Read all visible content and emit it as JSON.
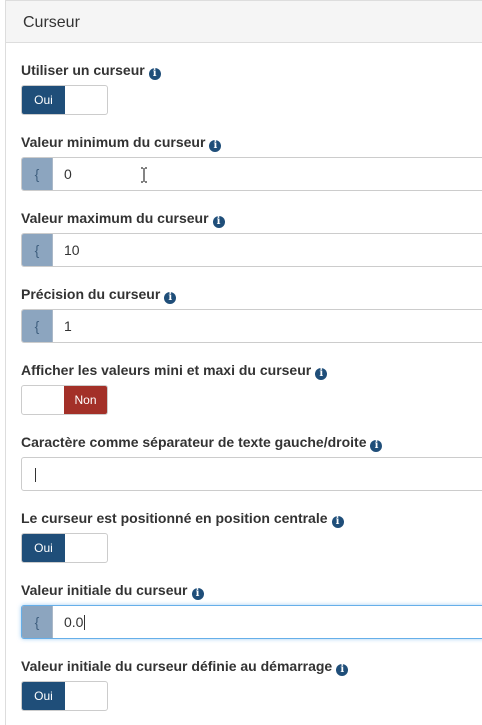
{
  "panel": {
    "title": "Curseur"
  },
  "info_glyph": "i",
  "fields": [
    {
      "label": "Utiliser un curseur",
      "type": "toggle",
      "state": "Oui"
    },
    {
      "label": "Valeur minimum du curseur",
      "type": "input",
      "addon": "{",
      "value": "0"
    },
    {
      "label": "Valeur maximum du curseur",
      "type": "input",
      "addon": "{",
      "value": "10"
    },
    {
      "label": "Précision du curseur",
      "type": "input",
      "addon": "{",
      "value": "1"
    },
    {
      "label": "Afficher les valeurs mini et maxi du curseur",
      "type": "toggle",
      "state": "Non"
    },
    {
      "label": "Caractère comme séparateur de texte gauche/droite",
      "type": "text",
      "value": ""
    },
    {
      "label": "Le curseur est positionné en position centrale",
      "type": "toggle",
      "state": "Oui"
    },
    {
      "label": "Valeur initiale du curseur",
      "type": "input",
      "addon": "{",
      "value": "0.0",
      "focused": true
    },
    {
      "label": "Valeur initiale du curseur définie au démarrage",
      "type": "toggle",
      "state": "Oui"
    }
  ],
  "colors": {
    "on": "#1f4e79",
    "off": "#a33028",
    "addon": "#8ca5bf"
  }
}
